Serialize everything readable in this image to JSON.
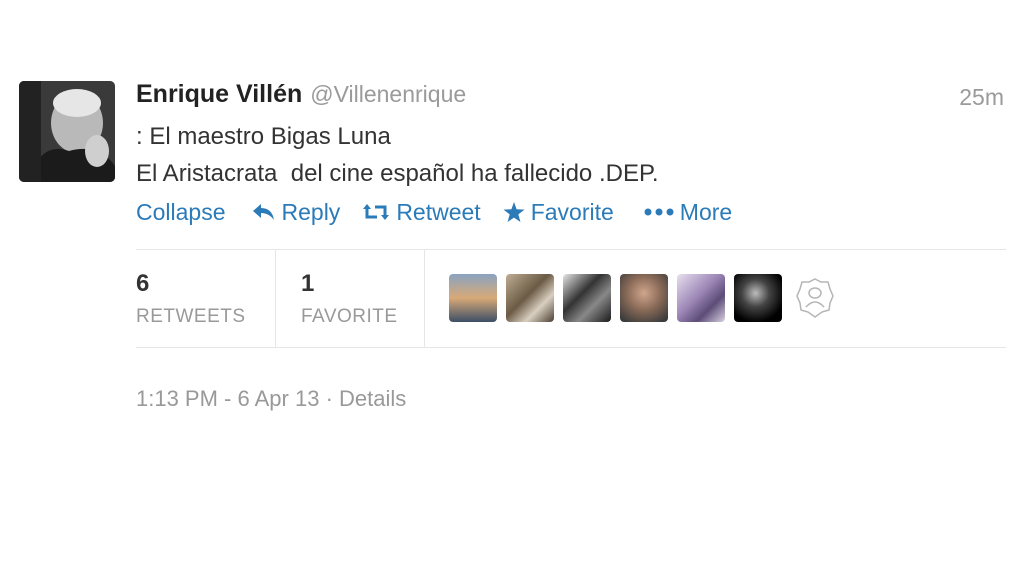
{
  "tweet": {
    "author": {
      "fullname": "Enrique Villén",
      "username": "@Villenenrique"
    },
    "time_ago": "25m",
    "text_lines": [
      ": El maestro Bigas Luna",
      "El Aristacrata  del cine español ha fallecido .DEP."
    ],
    "actions": {
      "collapse": "Collapse",
      "reply": "Reply",
      "retweet": "Retweet",
      "favorite": "Favorite",
      "more": "More"
    },
    "stats": {
      "retweets_count": "6",
      "retweets_label": "RETWEETS",
      "favorites_count": "1",
      "favorites_label": "FAVORITE"
    },
    "footer": {
      "timestamp": "1:13 PM - 6 Apr 13",
      "separator": "·",
      "details": "Details"
    }
  },
  "colors": {
    "link": "#2b7bb9",
    "muted": "#999999",
    "text": "#333333",
    "name": "#222222"
  },
  "icons": {
    "reply": "reply-arrow-icon",
    "retweet": "retweet-icon",
    "favorite": "star-icon",
    "more": "ellipsis-icon",
    "retweeters_more": "more-faces-icon"
  }
}
